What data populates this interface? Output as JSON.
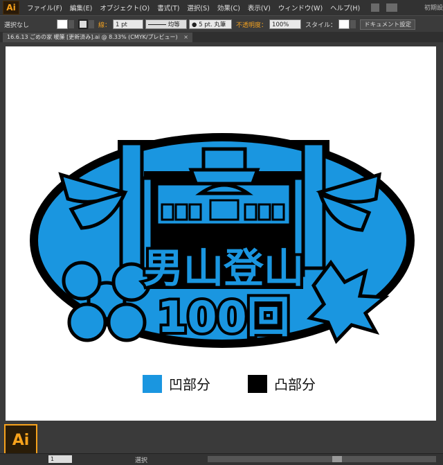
{
  "menubar": {
    "app_logo": "Ai",
    "items": [
      "ファイル(F)",
      "編集(E)",
      "オブジェクト(O)",
      "書式(T)",
      "選択(S)",
      "効果(C)",
      "表示(V)",
      "ウィンドウ(W)",
      "ヘルプ(H)"
    ],
    "right_label": "初期設"
  },
  "controlbar": {
    "selection": "選択なし",
    "stroke_label": "線：",
    "stroke_weight": "1 pt",
    "stroke_profile": "均等",
    "brush": "5 pt. 丸筆",
    "opacity_label": "不透明度：",
    "opacity": "100%",
    "style_label": "スタイル：",
    "doc_settings": "ドキュメント設定"
  },
  "tab": {
    "title": "16.6.13 ごめの家 暖簾 [更新済み].ai @ 8.33% (CMYK/プレビュー)",
    "close": "×"
  },
  "artwork": {
    "title_line1": "男山登山",
    "title_line2": "100回",
    "colors": {
      "recessed": "#1a96e0",
      "raised": "#000000"
    }
  },
  "legend": {
    "recessed": "凹部分",
    "raised": "凸部分"
  },
  "app_badge": "Ai",
  "statusbar": {
    "page": "1",
    "tool": "選択"
  }
}
